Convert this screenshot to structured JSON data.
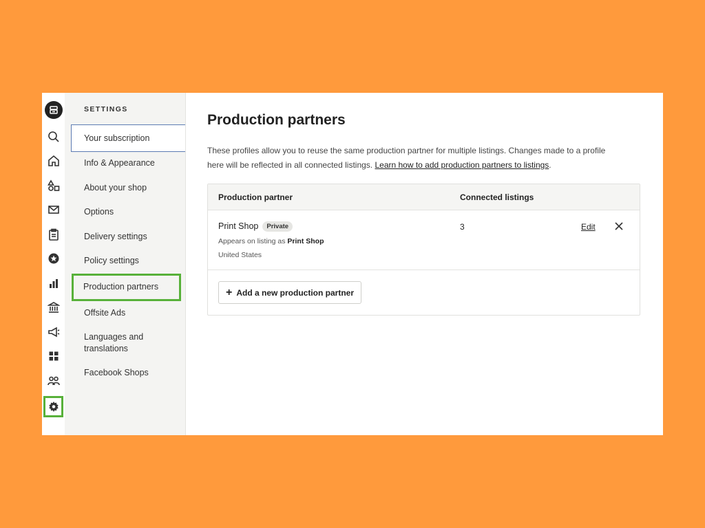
{
  "settings": {
    "heading": "SETTINGS",
    "items": [
      {
        "label": "Your subscription"
      },
      {
        "label": "Info & Appearance"
      },
      {
        "label": "About your shop"
      },
      {
        "label": "Options"
      },
      {
        "label": "Delivery settings"
      },
      {
        "label": "Policy settings"
      },
      {
        "label": "Production partners"
      },
      {
        "label": "Offsite Ads"
      },
      {
        "label": "Languages and translations"
      },
      {
        "label": "Facebook Shops"
      }
    ]
  },
  "page": {
    "title": "Production partners",
    "intro": "These profiles allow you to reuse the same production partner for multiple listings. Changes made to a profile here will be reflected in all connected listings. ",
    "learn_link": "Learn how to add production partners to listings",
    "intro_end": "."
  },
  "table": {
    "headers": {
      "partner": "Production partner",
      "connected": "Connected listings"
    },
    "rows": [
      {
        "name": "Print Shop",
        "badge": "Private",
        "appears_prefix": "Appears on listing as ",
        "appears_name": "Print Shop",
        "location": "United States",
        "connected": "3",
        "edit": "Edit"
      }
    ],
    "add_button": "Add a new production partner"
  },
  "icons": [
    "search-icon",
    "home-icon",
    "shapes-icon",
    "mail-icon",
    "clipboard-icon",
    "star-badge-icon",
    "bar-chart-icon",
    "bank-icon",
    "megaphone-icon",
    "grid-icon",
    "people-icon",
    "gear-icon"
  ],
  "colors": {
    "background": "#FF9A3C",
    "highlight": "#58B13A",
    "current_border": "#5C7BB3"
  }
}
